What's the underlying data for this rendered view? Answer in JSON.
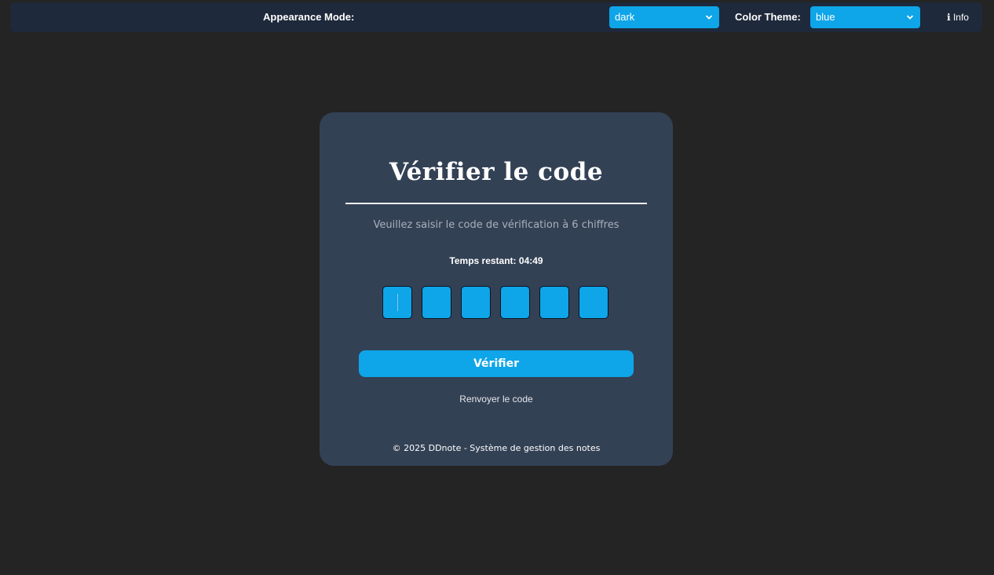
{
  "topbar": {
    "appearance_label": "Appearance Mode:",
    "appearance_value": "dark",
    "theme_label": "Color Theme:",
    "theme_value": "blue",
    "info_icon": "ℹ",
    "info_label": "Info"
  },
  "card": {
    "title": "Vérifier le code",
    "subtitle": "Veuillez saisir le code de vérification à 6 chiffres",
    "timer_label": "Temps restant:",
    "timer_value": "04:49",
    "otp_digits": [
      "",
      "",
      "",
      "",
      "",
      ""
    ],
    "verify_label": "Vérifier",
    "resend_label": "Renvoyer le code",
    "footer": "© 2025 DDnote - Système de gestion des notes"
  },
  "colors": {
    "background": "#242424",
    "topbar": "#1e293b",
    "card": "#334155",
    "accent": "#0ea5e9"
  }
}
